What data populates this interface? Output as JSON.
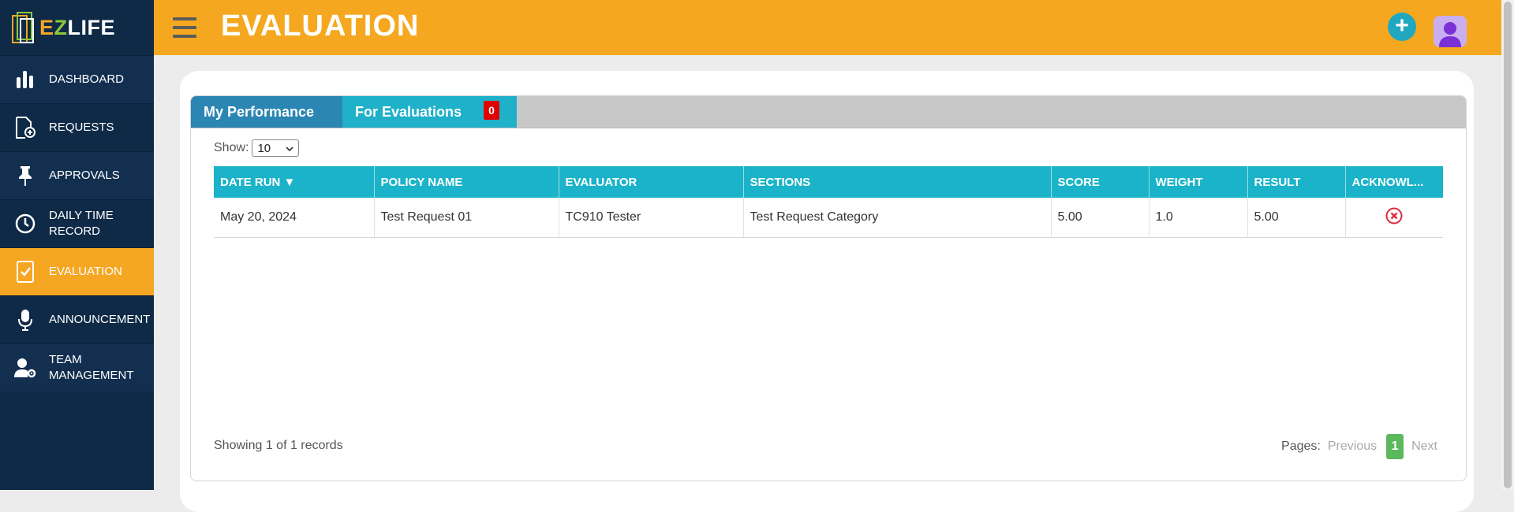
{
  "app": {
    "logo_e": "E",
    "logo_z": "Z",
    "logo_life": "LIFE"
  },
  "sidebar": {
    "items": [
      {
        "label": "DASHBOARD",
        "icon": "bar-chart-icon"
      },
      {
        "label": "REQUESTS",
        "icon": "document-plus-icon"
      },
      {
        "label": "APPROVALS",
        "icon": "pin-icon"
      },
      {
        "label": "DAILY TIME RECORD",
        "icon": "clock-icon"
      },
      {
        "label": "EVALUATION",
        "icon": "checklist-icon",
        "active": true
      },
      {
        "label": "ANNOUNCEMENT",
        "icon": "microphone-icon"
      },
      {
        "label": "TEAM MANAGEMENT",
        "icon": "user-gear-icon"
      }
    ]
  },
  "header": {
    "title": "EVALUATION",
    "add_icon": "plus-icon",
    "avatar_icon": "user-avatar-icon"
  },
  "tabs": [
    {
      "label": "My Performance",
      "active": true
    },
    {
      "label": "For Evaluations",
      "badge": "0"
    }
  ],
  "table": {
    "show_label": "Show:",
    "page_size": "10",
    "columns": [
      "DATE RUN ▼",
      "POLICY NAME",
      "EVALUATOR",
      "SECTIONS",
      "SCORE",
      "WEIGHT",
      "RESULT",
      "ACKNOWL..."
    ],
    "rows": [
      {
        "date_run": "May 20, 2024",
        "policy_name": "Test Request 01",
        "evaluator": "TC910 Tester",
        "sections": "Test Request Category",
        "score": "5.00",
        "weight": "1.0",
        "result": "5.00",
        "acknowledged_icon": "x-circle-icon"
      }
    ]
  },
  "footer": {
    "records_text": "Showing 1 of 1 records",
    "pages_label": "Pages:",
    "previous": "Previous",
    "current_page": "1",
    "next": "Next"
  },
  "colors": {
    "sidebar_bg": "#0f2a47",
    "accent_orange": "#f5a81f",
    "table_header": "#1bb3c9",
    "tab_active": "#2b86b3",
    "badge_red": "#e00000",
    "pager_green": "#5cb85c"
  }
}
